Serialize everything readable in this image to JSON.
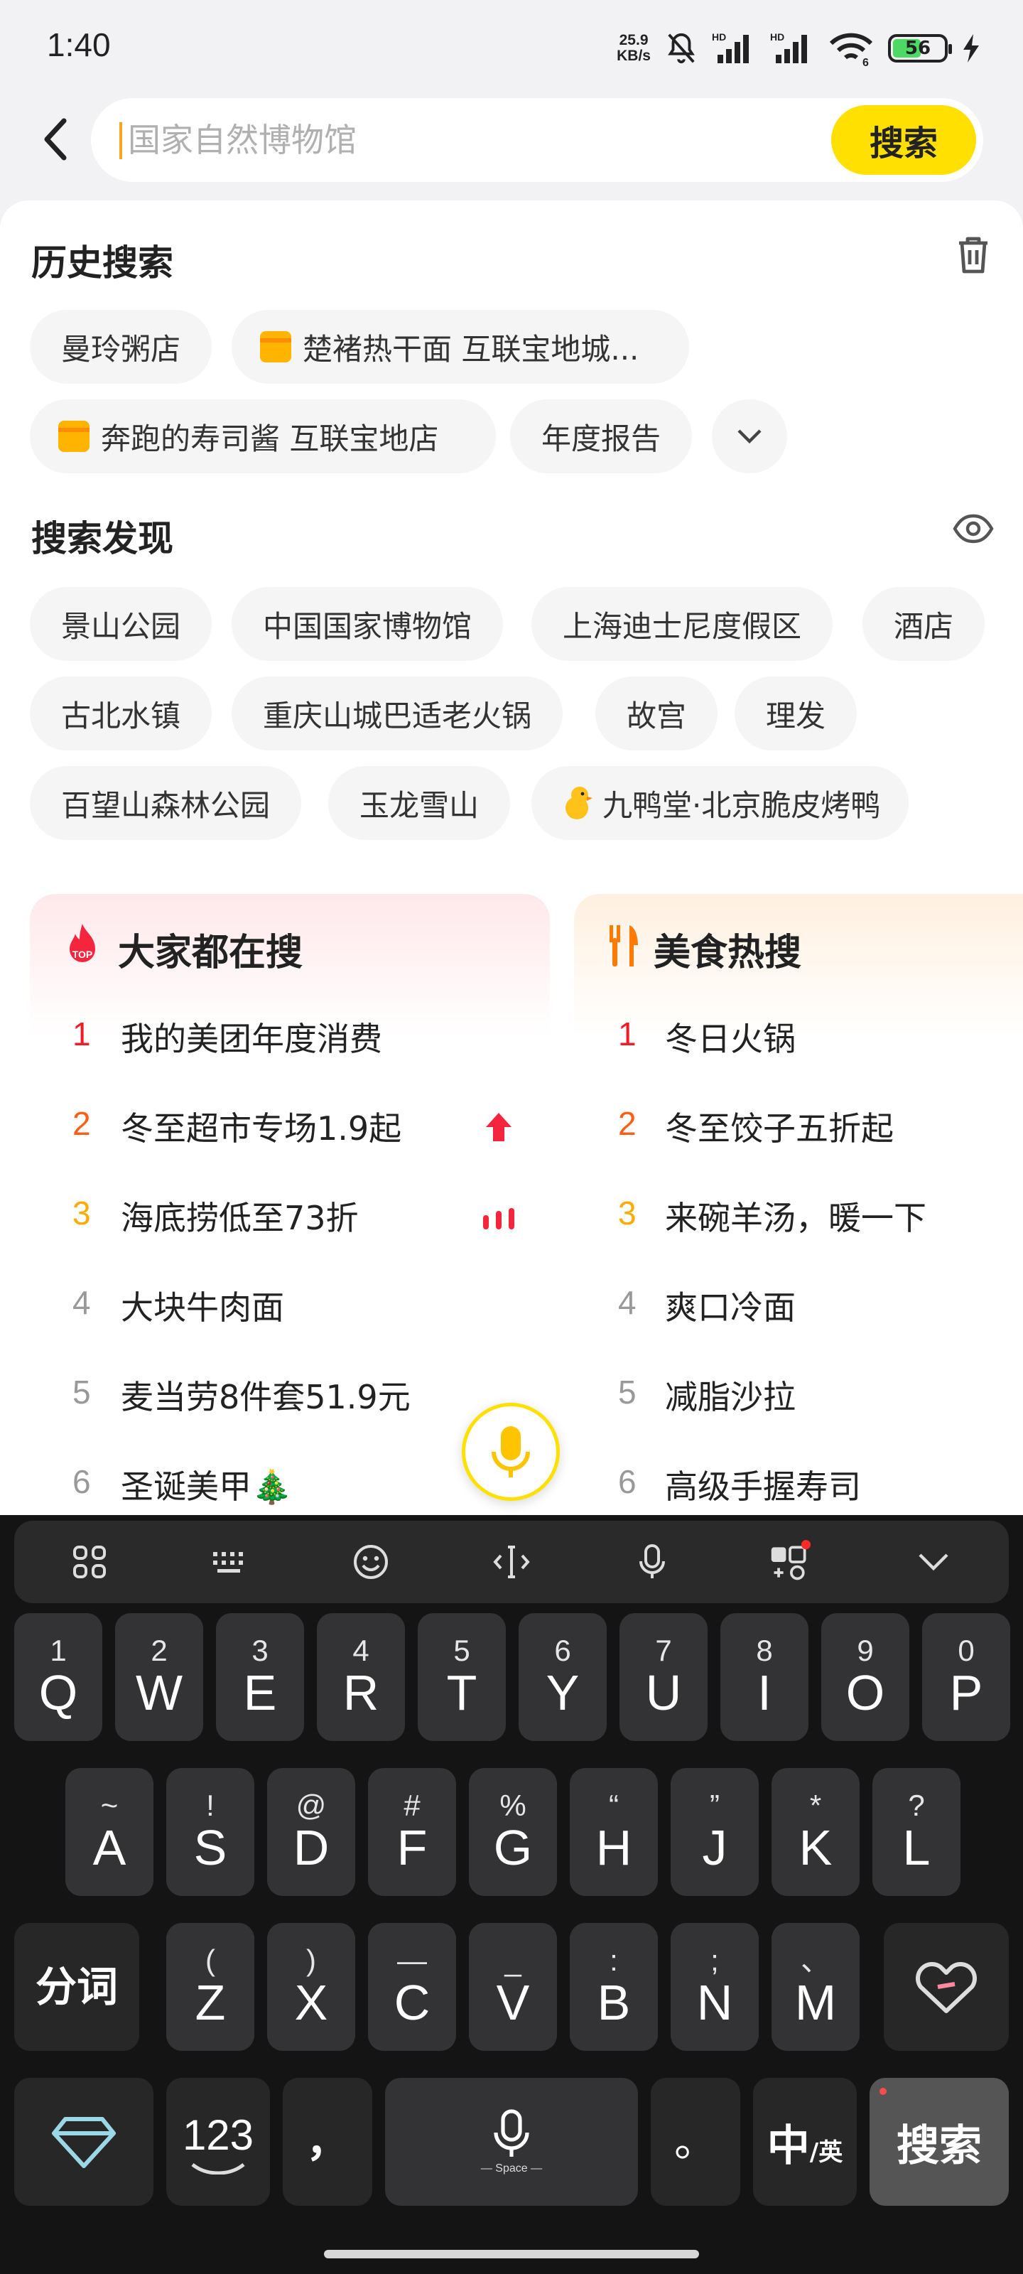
{
  "status_bar": {
    "time": "1:40",
    "net_speed_value": "25.9",
    "net_speed_unit": "KB/s",
    "battery": "56"
  },
  "search": {
    "placeholder": "国家自然博物馆",
    "button": "搜索"
  },
  "history": {
    "title": "历史搜索",
    "items": [
      "曼玲粥店",
      "楚褚热干面 互联宝地城...",
      "奔跑的寿司酱 互联宝地店",
      "年度报告"
    ]
  },
  "discover": {
    "title": "搜索发现",
    "items": [
      "景山公园",
      "中国国家博物馆",
      "上海迪士尼度假区",
      "酒店",
      "古北水镇",
      "重庆山城巴适老火锅",
      "故宫",
      "理发",
      "百望山森林公园",
      "玉龙雪山",
      "九鸭堂·北京脆皮烤鸭"
    ]
  },
  "hot_card": {
    "title": "大家都在搜",
    "badge": "TOP",
    "items": [
      {
        "rank": "1",
        "text": "我的美团年度消费"
      },
      {
        "rank": "2",
        "text": "冬至超市专场1.9起"
      },
      {
        "rank": "3",
        "text": "海底捞低至73折"
      },
      {
        "rank": "4",
        "text": "大块牛肉面"
      },
      {
        "rank": "5",
        "text": "麦当劳8件套51.9元"
      },
      {
        "rank": "6",
        "text": "圣诞美甲🎄"
      }
    ]
  },
  "food_card": {
    "title": "美食热搜",
    "items": [
      {
        "rank": "1",
        "text": "冬日火锅"
      },
      {
        "rank": "2",
        "text": "冬至饺子五折起"
      },
      {
        "rank": "3",
        "text": "来碗羊汤，暖一下"
      },
      {
        "rank": "4",
        "text": "爽口冷面"
      },
      {
        "rank": "5",
        "text": "减脂沙拉"
      },
      {
        "rank": "6",
        "text": "高级手握寿司"
      }
    ]
  },
  "keyboard": {
    "row1": [
      {
        "n": "1",
        "k": "Q"
      },
      {
        "n": "2",
        "k": "W"
      },
      {
        "n": "3",
        "k": "E"
      },
      {
        "n": "4",
        "k": "R"
      },
      {
        "n": "5",
        "k": "T"
      },
      {
        "n": "6",
        "k": "Y"
      },
      {
        "n": "7",
        "k": "U"
      },
      {
        "n": "8",
        "k": "I"
      },
      {
        "n": "9",
        "k": "O"
      },
      {
        "n": "0",
        "k": "P"
      }
    ],
    "row2": [
      {
        "n": "~",
        "k": "A"
      },
      {
        "n": "!",
        "k": "S"
      },
      {
        "n": "@",
        "k": "D"
      },
      {
        "n": "#",
        "k": "F"
      },
      {
        "n": "%",
        "k": "G"
      },
      {
        "n": "“",
        "k": "H"
      },
      {
        "n": "”",
        "k": "J"
      },
      {
        "n": "*",
        "k": "K"
      },
      {
        "n": "?",
        "k": "L"
      }
    ],
    "row3": [
      {
        "n": "(",
        "k": "Z"
      },
      {
        "n": ")",
        "k": "X"
      },
      {
        "n": "—",
        "k": "C"
      },
      {
        "n": "_",
        "k": "V"
      },
      {
        "n": ":",
        "k": "B"
      },
      {
        "n": ";",
        "k": "N"
      },
      {
        "n": "、",
        "k": "M"
      }
    ],
    "fenci": "分词",
    "num": "123",
    "comma": "，",
    "space": "— Space —",
    "period": "。",
    "lang_zh": "中",
    "lang_en": "/英",
    "search": "搜索"
  }
}
